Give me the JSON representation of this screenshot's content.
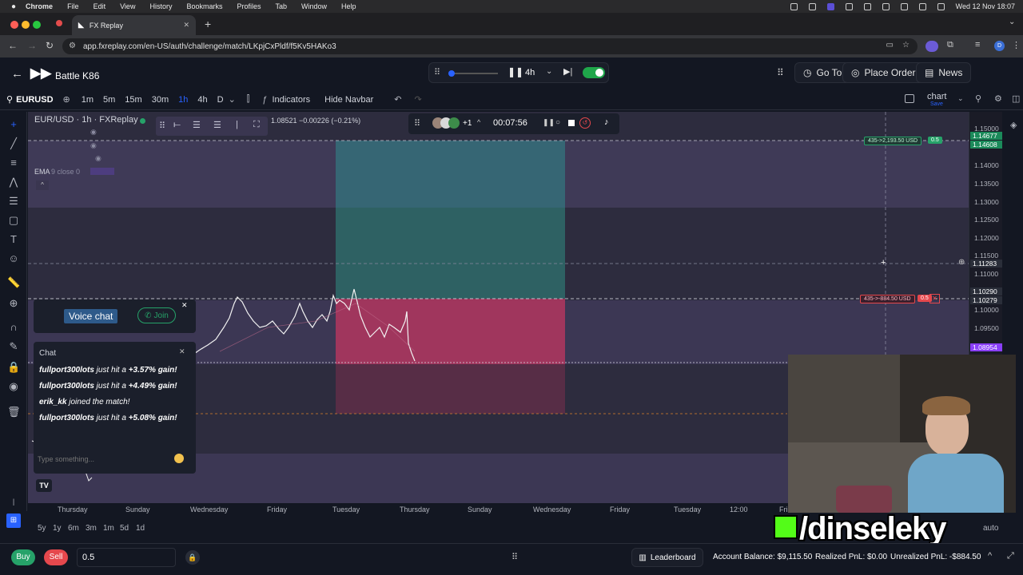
{
  "macos_menu": {
    "items": [
      "Chrome",
      "File",
      "Edit",
      "View",
      "History",
      "Bookmarks",
      "Profiles",
      "Tab",
      "Window",
      "Help"
    ],
    "clock": "Wed 12 Nov 18:07"
  },
  "browser": {
    "tab_title": "FX Replay",
    "url": "app.fxreplay.com/en-US/auth/challenge/match/LKpjCxPldf/f5Kv5HAKo3"
  },
  "app_header": {
    "title": "Battle K86",
    "timeframe": "4h",
    "goto_label": "Go To",
    "place_order_label": "Place Order",
    "news_label": "News"
  },
  "toolbar": {
    "symbol": "EURUSD",
    "timeframes": [
      "1m",
      "5m",
      "15m",
      "30m",
      "1h",
      "4h",
      "D"
    ],
    "active_timeframe": "1h",
    "indicators_label": "Indicators",
    "hide_navbar_label": "Hide Navbar",
    "layout_label": "chart",
    "layout_sub": "Save"
  },
  "chart_overlay": {
    "symbol_title": "EUR/USD · 1h · FXReplay",
    "ohlc_change": "1.08521  −0.00226 (−0.21%)",
    "ema_label": "EMA",
    "ema_params": "9 close 0",
    "timer": "00:07:56",
    "participants_extra": "+1",
    "tp_pill": "435->2,193.50 USD",
    "tp_qty": "0.5",
    "sl_pill": "435->-884.50 USD",
    "sl_qty": "0.5"
  },
  "y_axis": {
    "ticks": [
      "1.15000",
      "1.14000",
      "1.13500",
      "1.13000",
      "1.12500",
      "1.12000",
      "1.11500",
      "1.11000",
      "1.10000",
      "1.09500"
    ],
    "labels": [
      {
        "text": "1.14677",
        "color": "#1b8a5a"
      },
      {
        "text": "1.14608",
        "color": "#1b8a5a"
      },
      {
        "text": "1.11283",
        "color": "#2a2e39"
      },
      {
        "text": "1.10290",
        "color": "#2a2e39"
      },
      {
        "text": "1.10279",
        "color": "#2a2e39"
      },
      {
        "text": "1.08954",
        "color": "#8a3ffc"
      }
    ]
  },
  "x_axis": {
    "ticks": [
      "Thursday",
      "Sunday",
      "Wednesday",
      "Friday",
      "Tuesday",
      "Thursday",
      "Sunday",
      "Wednesday",
      "Friday",
      "Tuesday",
      "12:00",
      "Fri"
    ]
  },
  "range_bar": {
    "ranges": [
      "5y",
      "1y",
      "6m",
      "3m",
      "1m",
      "5d",
      "1d"
    ],
    "auto_label": "auto"
  },
  "voice_chat": {
    "label": "Voice chat",
    "join_label": "Join"
  },
  "chat": {
    "title": "Chat",
    "placeholder": "Type something...",
    "messages": [
      {
        "user": "fullport300lots",
        "text": " just hit a ",
        "gain": "+3.57% gain!"
      },
      {
        "user": "fullport300lots",
        "text": " just hit a ",
        "gain": "+4.49% gain!"
      },
      {
        "user": "erik_kk",
        "text": " joined the match!",
        "gain": ""
      },
      {
        "user": "fullport300lots",
        "text": " just hit a ",
        "gain": "+5.08% gain!"
      }
    ]
  },
  "bottom": {
    "buy_label": "Buy",
    "sell_label": "Sell",
    "quantity": "0.5",
    "leaderboard_label": "Leaderboard",
    "account_balance": "Account Balance: $9,115.50",
    "realized_pnl": "Realized PnL: $0.00",
    "unrealized_pnl": "Unrealized PnL: -$884.50"
  },
  "watermark_text": "/dinseleky",
  "colors": {
    "background": "#131722",
    "zone_purple": "#3b3651",
    "tp_zone": "#2f6b6a",
    "sl_zone": "#b2365f",
    "buy": "#26a269",
    "sell": "#e5484d",
    "toggle": "#1fa64a"
  }
}
